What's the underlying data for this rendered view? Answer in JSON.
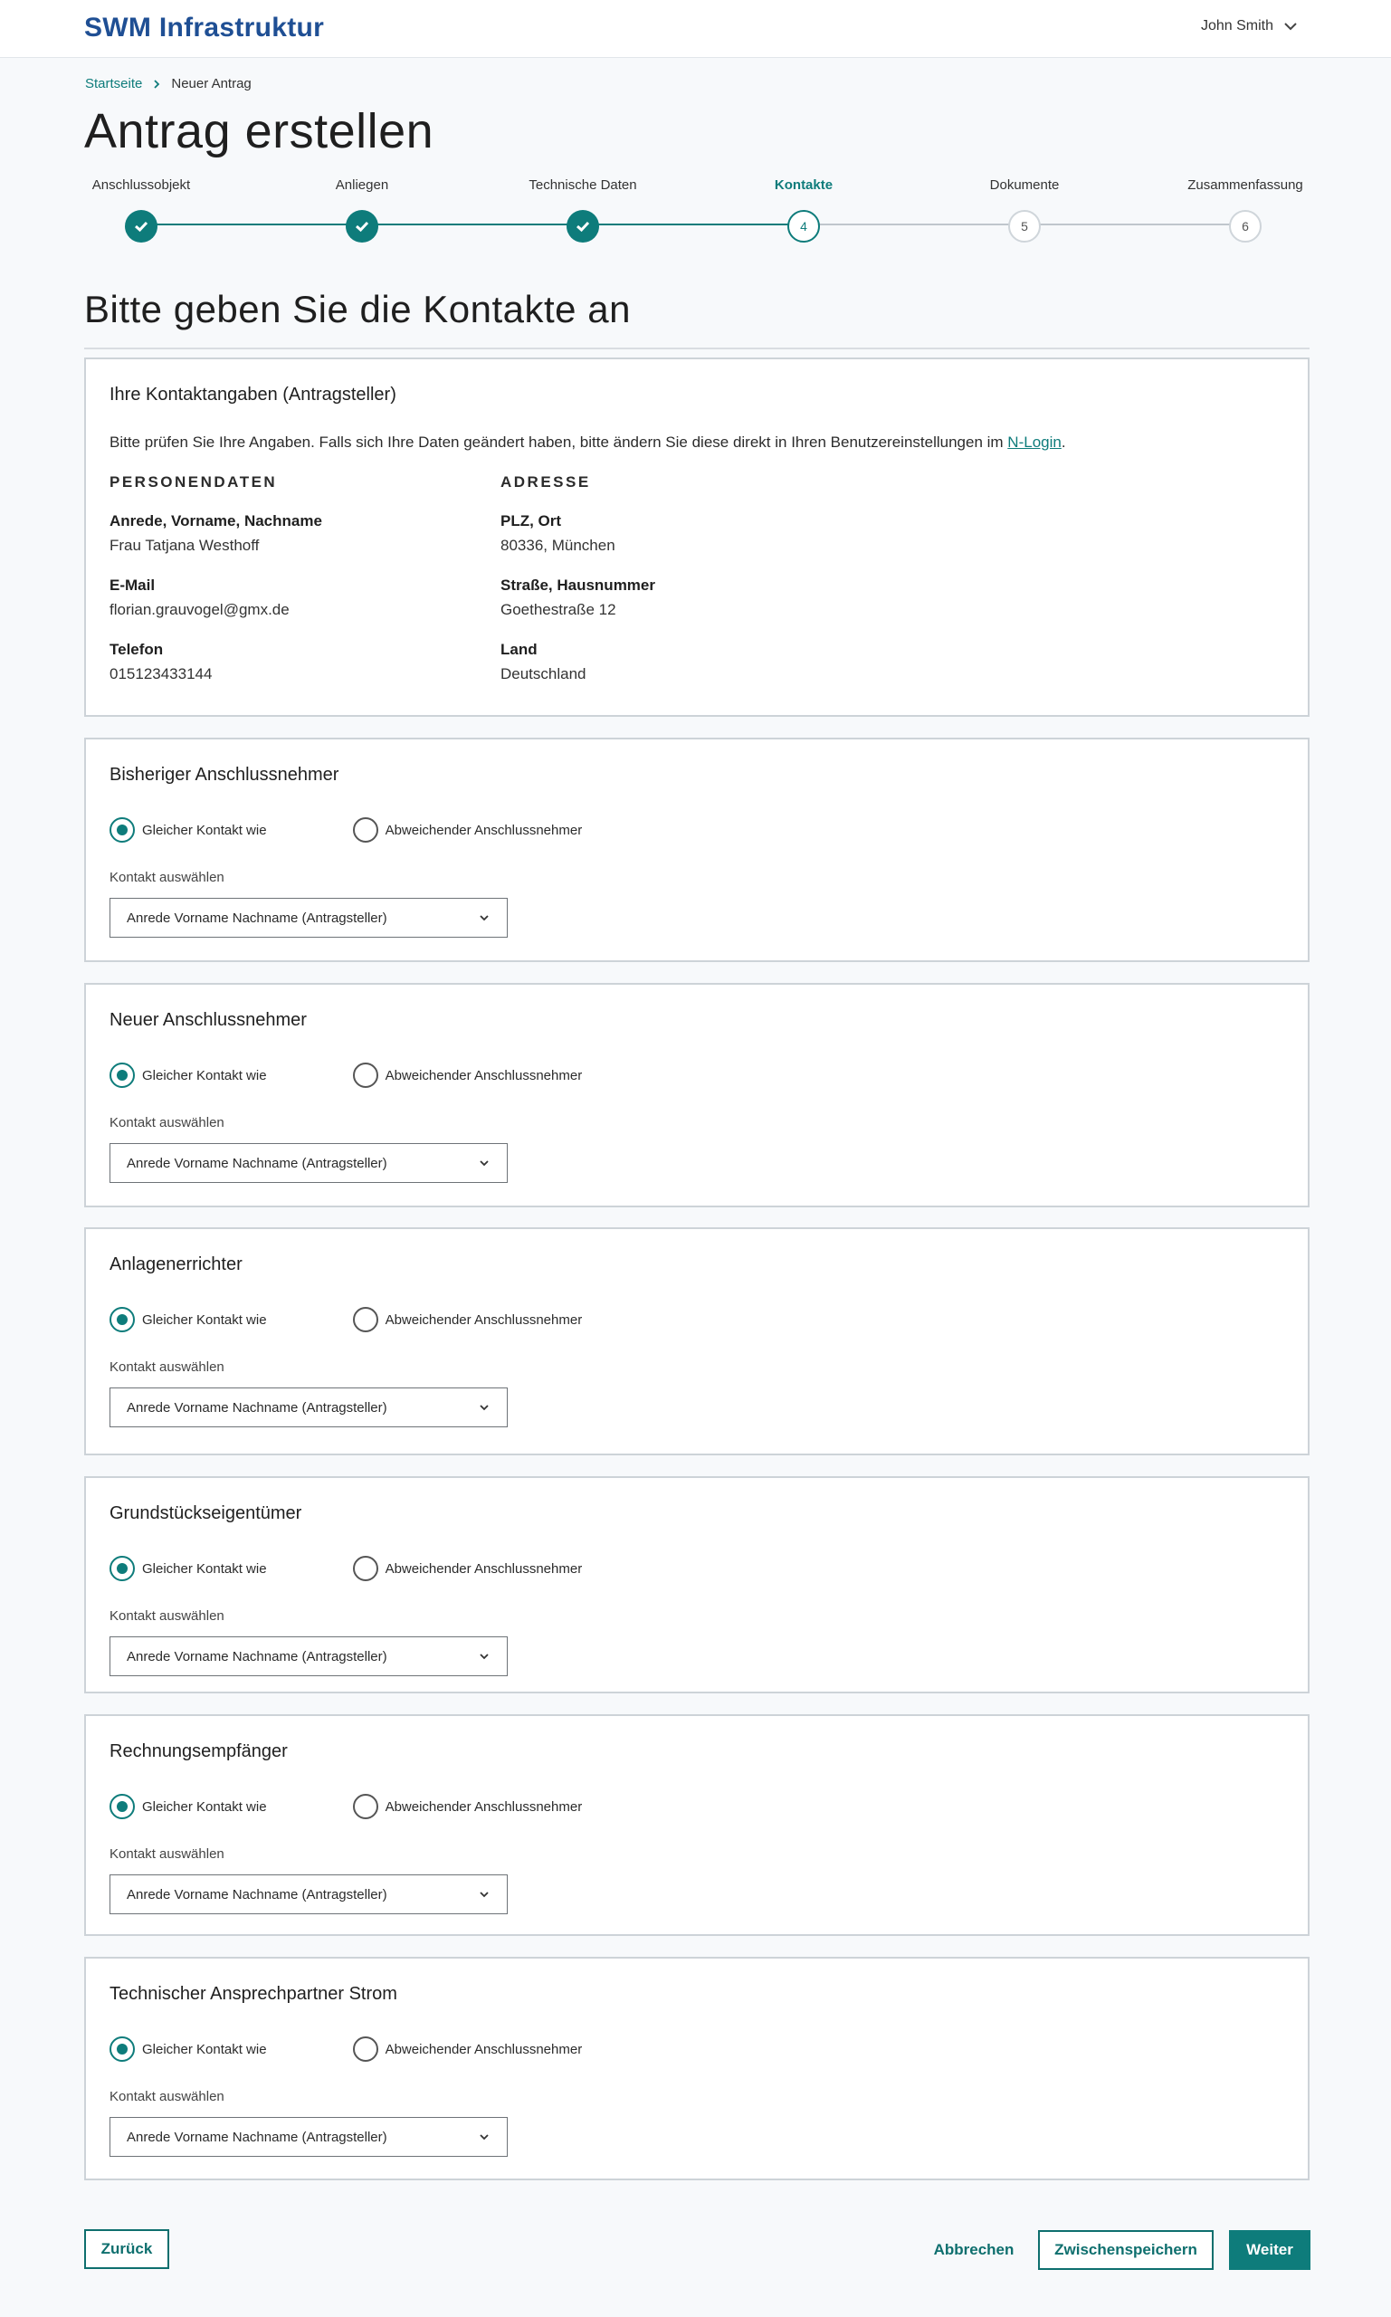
{
  "header": {
    "brand": "SWM Infrastruktur",
    "user_name": "John Smith"
  },
  "breadcrumb": {
    "home": "Startseite",
    "current": "Neuer Antrag"
  },
  "page_title": "Antrag erstellen",
  "stepper": {
    "steps": [
      {
        "label": "Anschlussobjekt",
        "number": "1",
        "state": "done"
      },
      {
        "label": "Anliegen",
        "number": "2",
        "state": "done"
      },
      {
        "label": "Technische Daten",
        "number": "3",
        "state": "done"
      },
      {
        "label": "Kontakte",
        "number": "4",
        "state": "active"
      },
      {
        "label": "Dokumente",
        "number": "5",
        "state": "todo"
      },
      {
        "label": "Zusammenfassung",
        "number": "6",
        "state": "todo"
      }
    ]
  },
  "section_title": "Bitte geben Sie die Kontakte an",
  "contact_card": {
    "title": "Ihre Kontaktangaben (Antragsteller)",
    "info_text": "Bitte prüfen Sie Ihre Angaben. Falls sich Ihre Daten geändert haben, bitte ändern Sie diese direkt in Ihren Benutzereinstellungen im ",
    "info_link": "N-Login",
    "info_end": ".",
    "person_heading": "PERSONENDATEN",
    "address_heading": "ADRESSE",
    "fields": {
      "name_label": "Anrede, Vorname, Nachname",
      "name_value": "Frau Tatjana Westhoff",
      "email_label": "E-Mail",
      "email_value": "florian.grauvogel@gmx.de",
      "phone_label": "Telefon",
      "phone_value": "015123433144",
      "city_label": "PLZ, Ort",
      "city_value": "80336, München",
      "street_label": "Straße, Hausnummer",
      "street_value": "Goethestraße 12",
      "country_label": "Land",
      "country_value": "Deutschland"
    }
  },
  "contact_sections": [
    {
      "title": "Bisheriger Anschlussnehmer",
      "option_same": "Gleicher Kontakt wie",
      "option_other": "Abweichender Anschlussnehmer",
      "select_label": "Kontakt auswählen",
      "select_value": "Anrede Vorname Nachname (Antragsteller)"
    },
    {
      "title": "Neuer Anschlussnehmer",
      "option_same": "Gleicher Kontakt wie",
      "option_other": "Abweichender Anschlussnehmer",
      "select_label": "Kontakt auswählen",
      "select_value": "Anrede Vorname Nachname (Antragsteller)"
    },
    {
      "title": "Anlagenerrichter",
      "option_same": "Gleicher Kontakt wie",
      "option_other": "Abweichender Anschlussnehmer",
      "select_label": "Kontakt auswählen",
      "select_value": "Anrede Vorname Nachname (Antragsteller)"
    },
    {
      "title": "Grundstückseigentümer",
      "option_same": "Gleicher Kontakt wie",
      "option_other": "Abweichender Anschlussnehmer",
      "select_label": "Kontakt auswählen",
      "select_value": "Anrede Vorname Nachname (Antragsteller)"
    },
    {
      "title": "Rechnungsempfänger",
      "option_same": "Gleicher Kontakt wie",
      "option_other": "Abweichender Anschlussnehmer",
      "select_label": "Kontakt auswählen",
      "select_value": "Anrede Vorname Nachname (Antragsteller)"
    },
    {
      "title": "Technischer Ansprechpartner Strom",
      "option_same": "Gleicher Kontakt wie",
      "option_other": "Abweichender Anschlussnehmer",
      "select_label": "Kontakt auswählen",
      "select_value": "Anrede Vorname Nachname (Antragsteller)"
    }
  ],
  "footer": {
    "back": "Zurück",
    "cancel": "Abbrechen",
    "save": "Zwischenspeichern",
    "next": "Weiter"
  },
  "colors": {
    "accent": "#0e7c7b",
    "brand": "#1f4f94"
  }
}
